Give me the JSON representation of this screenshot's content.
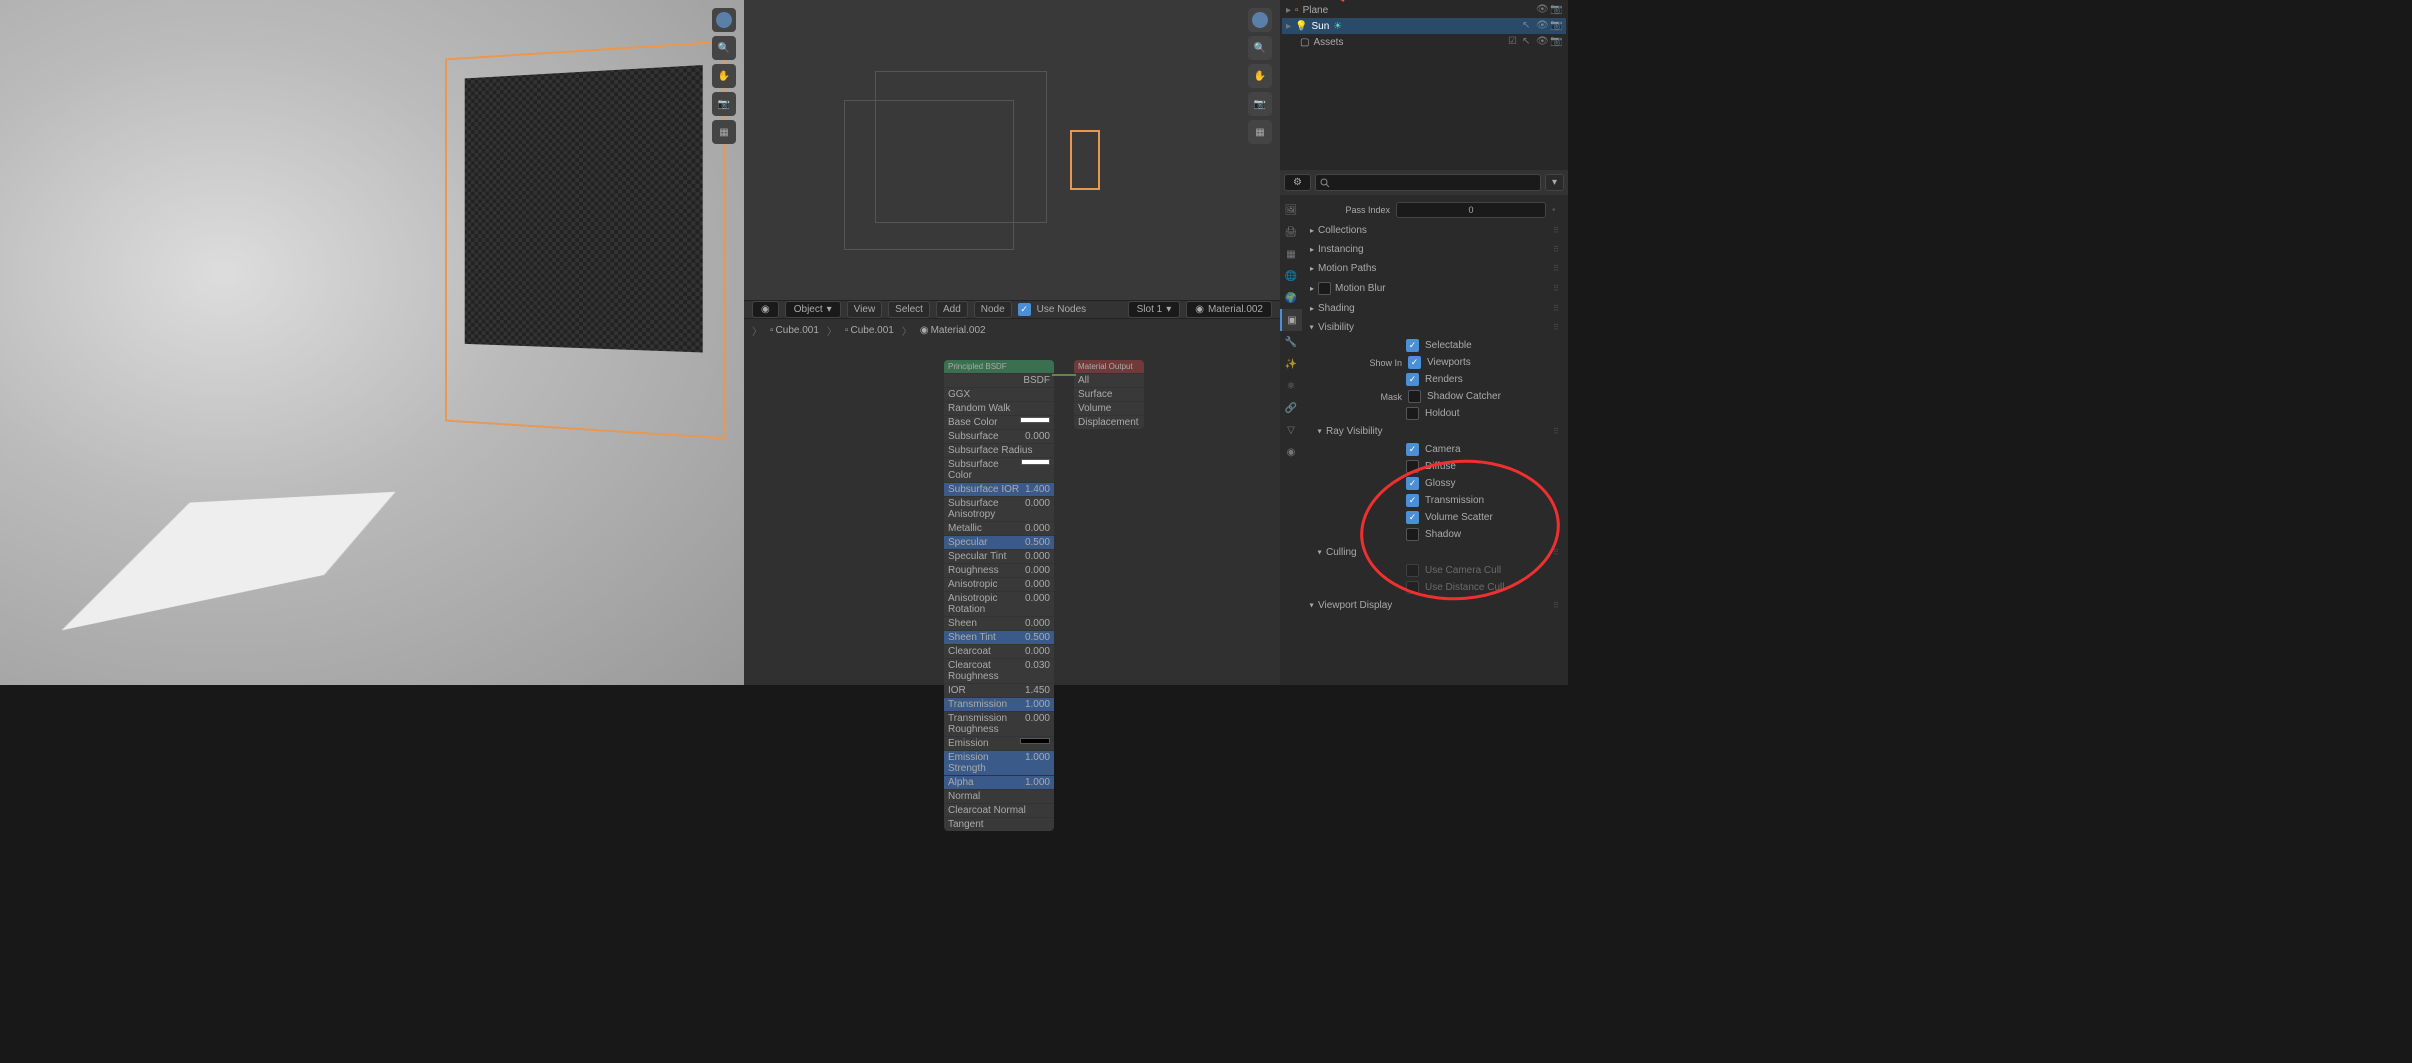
{
  "outliner": {
    "items": [
      {
        "name": "Plane",
        "icon": "mesh"
      },
      {
        "name": "Sun",
        "icon": "light",
        "selected": true
      },
      {
        "name": "Assets",
        "icon": "collection"
      }
    ]
  },
  "node_header": {
    "editor": "Object",
    "menus": [
      "View",
      "Select",
      "Add",
      "Node"
    ],
    "use_nodes_label": "Use Nodes",
    "use_nodes": true,
    "slot": "Slot 1",
    "material": "Material.002"
  },
  "breadcrumb": {
    "items": [
      "Cube.001",
      "Cube.001",
      "Material.002"
    ]
  },
  "nodes": {
    "bsdf": {
      "title": "Principled BSDF",
      "dist": "GGX",
      "sss": "Random Walk",
      "rows": [
        {
          "label": "Base Color",
          "color": "#fff"
        },
        {
          "label": "Subsurface",
          "val": "0.000"
        },
        {
          "label": "Subsurface Radius"
        },
        {
          "label": "Subsurface Color",
          "color": "#fff"
        },
        {
          "label": "Subsurface IOR",
          "val": "1.400",
          "blue": true
        },
        {
          "label": "Subsurface Anisotropy",
          "val": "0.000"
        },
        {
          "label": "Metallic",
          "val": "0.000"
        },
        {
          "label": "Specular",
          "val": "0.500",
          "blue": true
        },
        {
          "label": "Specular Tint",
          "val": "0.000"
        },
        {
          "label": "Roughness",
          "val": "0.000"
        },
        {
          "label": "Anisotropic",
          "val": "0.000"
        },
        {
          "label": "Anisotropic Rotation",
          "val": "0.000"
        },
        {
          "label": "Sheen",
          "val": "0.000"
        },
        {
          "label": "Sheen Tint",
          "val": "0.500",
          "blue": true
        },
        {
          "label": "Clearcoat",
          "val": "0.000"
        },
        {
          "label": "Clearcoat Roughness",
          "val": "0.030"
        },
        {
          "label": "IOR",
          "val": "1.450"
        },
        {
          "label": "Transmission",
          "val": "1.000",
          "blue": true
        },
        {
          "label": "Transmission Roughness",
          "val": "0.000"
        },
        {
          "label": "Emission",
          "color": "#000"
        },
        {
          "label": "Emission Strength",
          "val": "1.000",
          "blue": true
        },
        {
          "label": "Alpha",
          "val": "1.000",
          "blue": true
        },
        {
          "label": "Normal"
        },
        {
          "label": "Clearcoat Normal"
        },
        {
          "label": "Tangent"
        }
      ],
      "out": "BSDF"
    },
    "output": {
      "title": "Material Output",
      "target": "All",
      "ins": [
        "Surface",
        "Volume",
        "Displacement"
      ]
    }
  },
  "properties": {
    "search_placeholder": "",
    "pass_index": {
      "label": "Pass Index",
      "value": "0"
    },
    "collections": "Collections",
    "instancing": "Instancing",
    "motion_paths": "Motion Paths",
    "motion_blur": {
      "label": "Motion Blur",
      "checked": false
    },
    "shading": "Shading",
    "visibility": {
      "title": "Visibility",
      "selectable": {
        "label": "Selectable",
        "checked": true
      },
      "show_in": "Show In",
      "viewports": {
        "label": "Viewports",
        "checked": true
      },
      "renders": {
        "label": "Renders",
        "checked": true
      },
      "mask": "Mask",
      "shadow_catcher": {
        "label": "Shadow Catcher",
        "checked": false
      },
      "holdout": {
        "label": "Holdout",
        "checked": false
      }
    },
    "ray_visibility": {
      "title": "Ray Visibility",
      "camera": {
        "label": "Camera",
        "checked": true
      },
      "diffuse": {
        "label": "Diffuse",
        "checked": false
      },
      "glossy": {
        "label": "Glossy",
        "checked": true
      },
      "transmission": {
        "label": "Transmission",
        "checked": true
      },
      "volume_scatter": {
        "label": "Volume Scatter",
        "checked": true
      },
      "shadow": {
        "label": "Shadow",
        "checked": false
      }
    },
    "culling": {
      "title": "Culling",
      "camera_cull": {
        "label": "Use Camera Cull",
        "checked": false
      },
      "distance_cull": {
        "label": "Use Distance Cull",
        "checked": false
      }
    },
    "viewport_display": "Viewport Display"
  }
}
